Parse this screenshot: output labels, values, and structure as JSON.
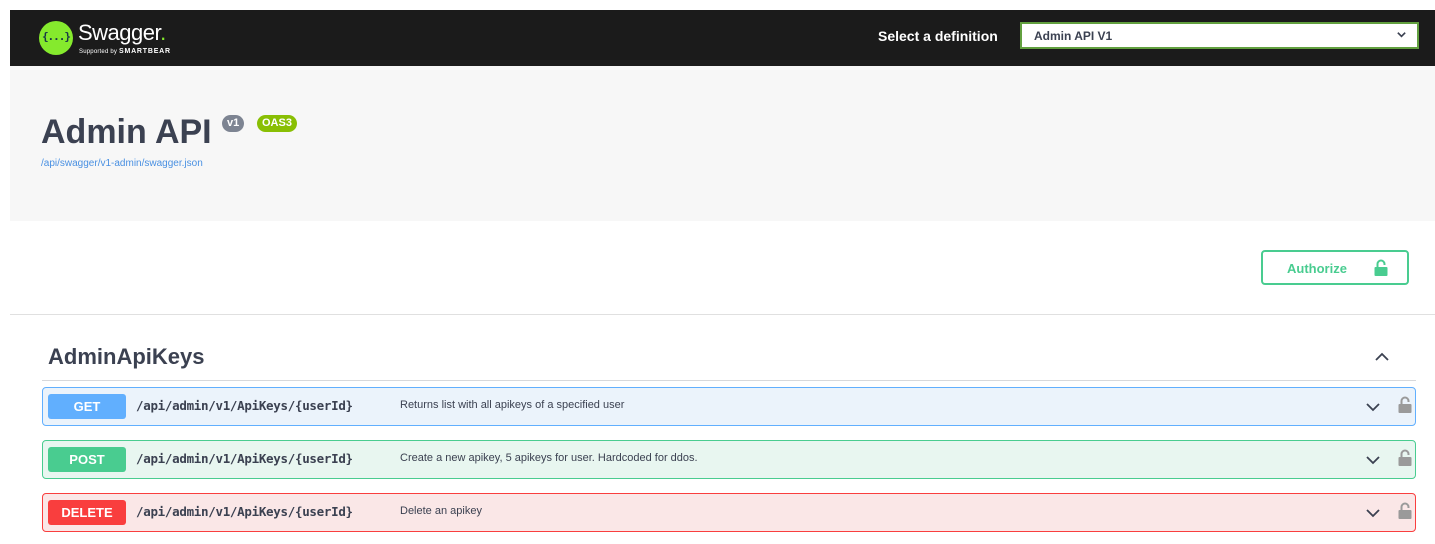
{
  "topbar": {
    "logo_icon_text": "{...}",
    "logo_title": "Swagger",
    "logo_dot": ".",
    "logo_sub_prefix": "Supported by ",
    "logo_sub_brand": "SMARTBEAR",
    "select_label": "Select a definition",
    "select_value": "Admin API V1"
  },
  "info": {
    "title": "Admin API",
    "version_badge": "v1",
    "oas_badge": "OAS3",
    "url": "/api/swagger/v1-admin/swagger.json"
  },
  "authorize": {
    "label": "Authorize",
    "icon": "unlock-icon"
  },
  "tag": {
    "name": "AdminApiKeys",
    "toggle_icon": "chevron-up-icon"
  },
  "operations": [
    {
      "method": "GET",
      "path": "/api/admin/v1/ApiKeys/{userId}",
      "summary": "Returns list with all apikeys of a specified user"
    },
    {
      "method": "POST",
      "path": "/api/admin/v1/ApiKeys/{userId}",
      "summary": "Create a new apikey, 5 apikeys for user. Hardcoded for ddos."
    },
    {
      "method": "DELETE",
      "path": "/api/admin/v1/ApiKeys/{userId}",
      "summary": "Delete an apikey"
    }
  ],
  "colors": {
    "topbar_bg": "#1b1b1b",
    "brand_green": "#85ea2d",
    "get": "#61affe",
    "post": "#49cc90",
    "delete": "#f93e3e",
    "authorize": "#49cc90"
  }
}
